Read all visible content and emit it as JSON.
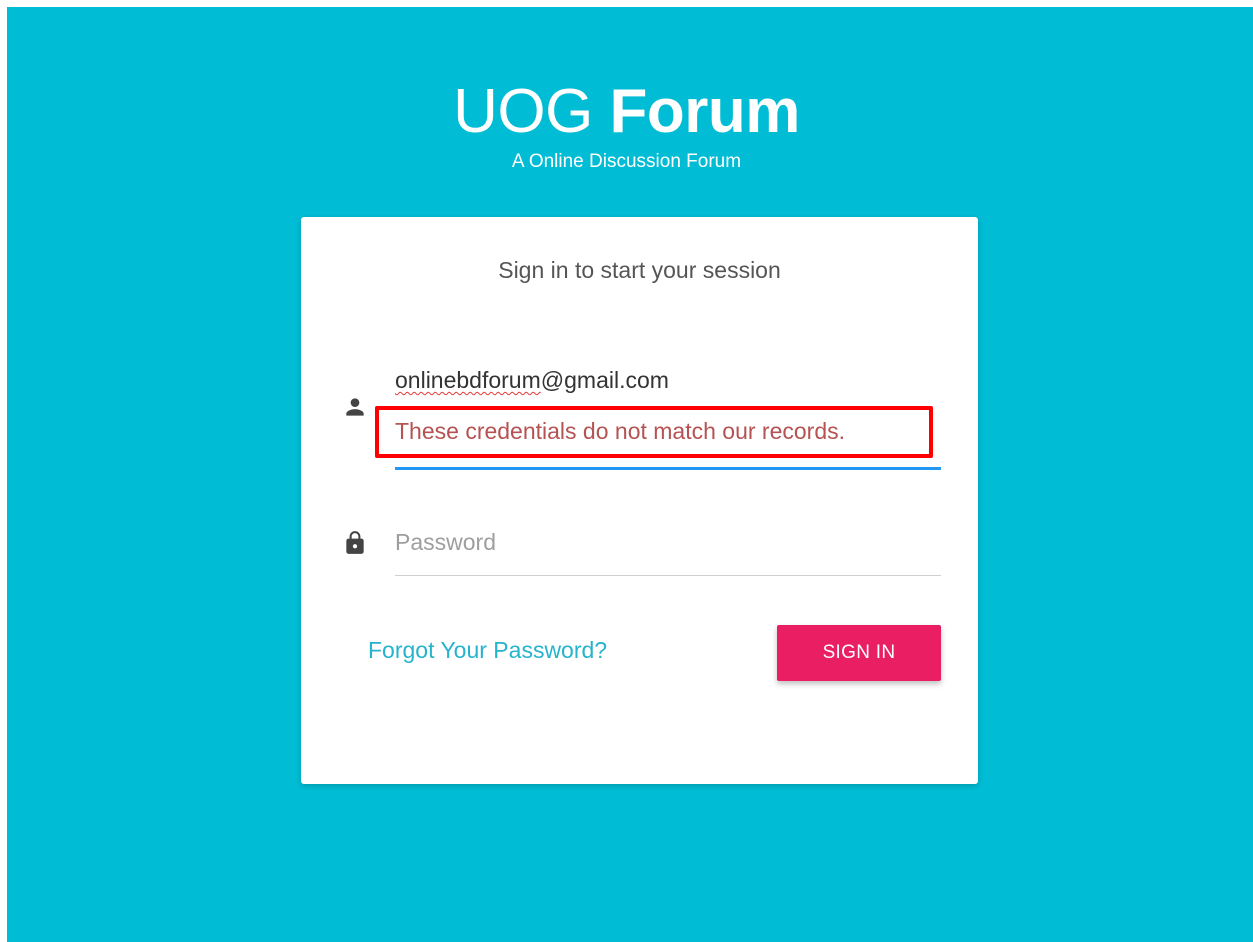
{
  "brand": {
    "title_light": "UOG",
    "title_bold": "Forum",
    "subtitle": "A Online Discussion Forum"
  },
  "login": {
    "heading": "Sign in to start your session",
    "email": {
      "value_spell": "onlinebdforum",
      "value_rest": "@gmail.com",
      "icon": "person-icon",
      "error": "These credentials do not match our records."
    },
    "password": {
      "placeholder": "Password",
      "value": "",
      "icon": "lock-icon"
    },
    "forgot_label": "Forgot Your Password?",
    "submit_label": "SIGN IN"
  },
  "colors": {
    "background": "#00bcd4",
    "primary_button": "#e91e63",
    "link": "#26b3cc",
    "focus_underline": "#2196f3",
    "error_highlight": "#ff0000"
  }
}
